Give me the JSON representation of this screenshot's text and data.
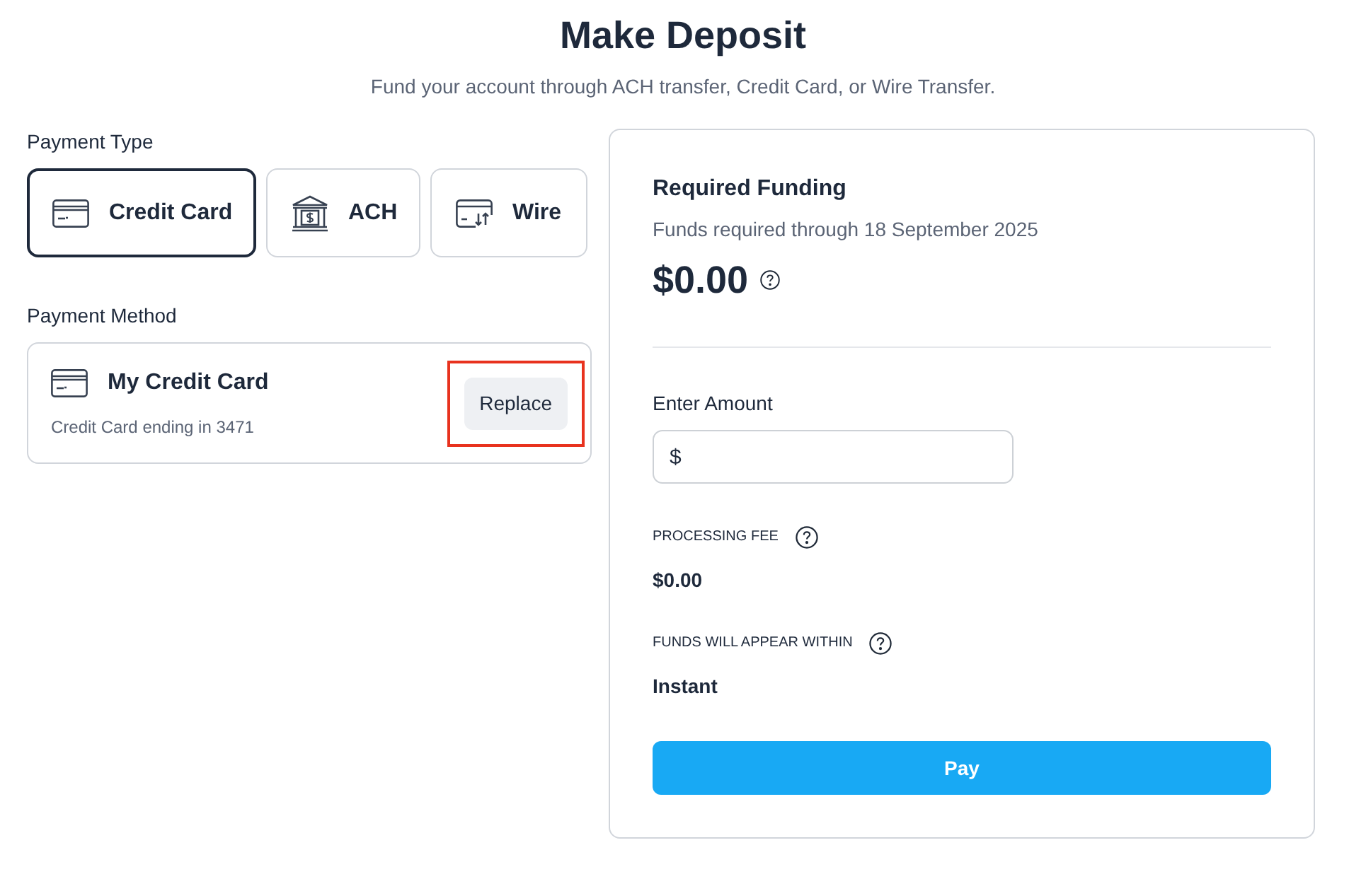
{
  "header": {
    "title": "Make Deposit",
    "subtitle": "Fund your account through ACH transfer, Credit Card, or Wire Transfer."
  },
  "payment_type": {
    "label": "Payment Type",
    "options": [
      {
        "kind": "card",
        "label": "Credit Card",
        "selected": true
      },
      {
        "kind": "bank",
        "label": "ACH",
        "selected": false
      },
      {
        "kind": "wire",
        "label": "Wire",
        "selected": false
      }
    ]
  },
  "payment_method": {
    "label": "Payment Method",
    "card": {
      "kind": "card",
      "name": "My Credit Card",
      "detail": "Credit Card ending in 3471",
      "button": {
        "label": "Replace",
        "highlighted": true
      }
    }
  },
  "funding": {
    "title": "Required Funding",
    "note": "Funds required through 18 September 2025",
    "amount": "$0.00",
    "amount_field": {
      "label": "Enter Amount",
      "placeholder": "$"
    },
    "fee": {
      "label": "PROCESSING FEE",
      "value": "$0.00"
    },
    "timing": {
      "label": "FUNDS WILL APPEAR WITHIN",
      "value": "Instant"
    },
    "button": "Pay"
  }
}
